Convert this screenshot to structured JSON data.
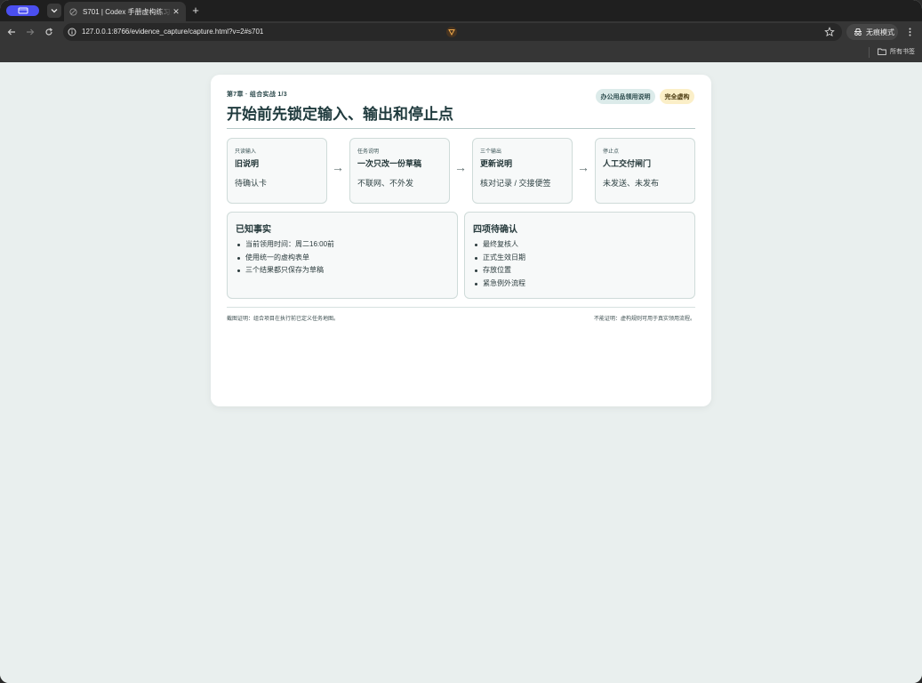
{
  "browser": {
    "tab": {
      "title": "S701 | Codex 手册虚构练习产品",
      "favicon": "globe-icon"
    },
    "address_bar": {
      "url": "127.0.0.1:8766/evidence_capture/capture.html?v=2#s701"
    },
    "incognito_label": "无痕模式",
    "bookmarks": {
      "all_bookmarks_label": "所有书签"
    },
    "colors": {
      "profile_pill": "#4b4ff0",
      "tabstrip_bg": "#1f1f1f",
      "toolbar_bg": "#363636"
    }
  },
  "page": {
    "eyebrow": "第7章 · 组合实战 1/3",
    "title": "开始前先锁定输入、输出和停止点",
    "badges": {
      "primary": "办公用品领用说明",
      "secondary": "完全虚构"
    },
    "steps": [
      {
        "kicker": "只读输入",
        "name": "旧说明",
        "detail": "待确认卡"
      },
      {
        "kicker": "任务说明",
        "name": "一次只改一份草稿",
        "detail": "不联网、不外发"
      },
      {
        "kicker": "三个输出",
        "name": "更新说明",
        "detail": "核对记录 / 交接便签"
      },
      {
        "kicker": "停止点",
        "name": "人工交付闸门",
        "detail": "未发送、未发布"
      }
    ],
    "arrow_glyph": "→",
    "known_facts": {
      "title": "已知事实",
      "items": [
        "当前领用时间：周二16:00前",
        "使用统一的虚构表单",
        "三个结果都只保存为草稿"
      ]
    },
    "pending": {
      "title": "四项待确认",
      "items": [
        "最终复核人",
        "正式生效日期",
        "存放位置",
        "紧急例外流程"
      ]
    },
    "footer": {
      "left": "截图证明：组合项目在执行前已定义任务地图。",
      "right": "不能证明：虚构规则可用于真实领用流程。"
    },
    "colors": {
      "background": "#e9efee",
      "title": "#1f3a3d",
      "badge_primary_bg": "#dcebea",
      "badge_secondary_bg": "#fbefc8"
    }
  }
}
